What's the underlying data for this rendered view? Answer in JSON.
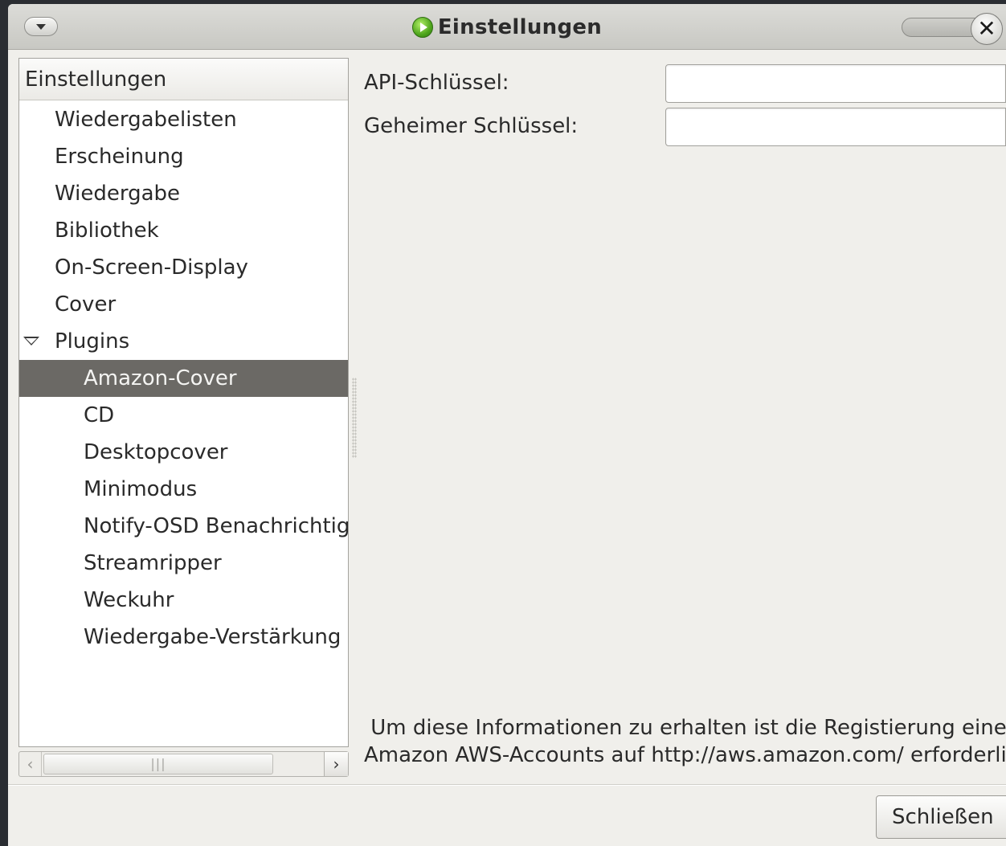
{
  "window": {
    "title": "Einstellungen"
  },
  "tree": {
    "header": "Einstellungen",
    "items": [
      {
        "label": "Wiedergabelisten",
        "level": 1
      },
      {
        "label": "Erscheinung",
        "level": 1
      },
      {
        "label": "Wiedergabe",
        "level": 1
      },
      {
        "label": "Bibliothek",
        "level": 1
      },
      {
        "label": "On-Screen-Display",
        "level": 1
      },
      {
        "label": "Cover",
        "level": 1
      },
      {
        "label": "Plugins",
        "level": 1,
        "expanded": true
      },
      {
        "label": "Amazon-Cover",
        "level": 2,
        "selected": true
      },
      {
        "label": "CD",
        "level": 2
      },
      {
        "label": "Desktopcover",
        "level": 2
      },
      {
        "label": "Minimodus",
        "level": 2
      },
      {
        "label": "Notify-OSD Benachrichtig",
        "level": 2
      },
      {
        "label": "Streamripper",
        "level": 2
      },
      {
        "label": "Weckuhr",
        "level": 2
      },
      {
        "label": "Wiedergabe-Verstärkung",
        "level": 2
      }
    ]
  },
  "scrollbar": {
    "left_arrow": "‹",
    "thumb_grip": "|||",
    "right_arrow": "›"
  },
  "form": {
    "api_key_label": "API-Schlüssel:",
    "api_key_value": "",
    "secret_key_label": "Geheimer Schlüssel:",
    "secret_key_value": ""
  },
  "info": {
    "line1": " Um diese Informationen zu erhalten ist die Registierung eine",
    "line2": "Amazon AWS-Accounts auf http://aws.amazon.com/ erforderli"
  },
  "buttons": {
    "close_label": "Schließen"
  },
  "colors": {
    "selection": "#6b6965",
    "window_bg": "#f0efeb",
    "app_icon": "#4ea51c"
  }
}
